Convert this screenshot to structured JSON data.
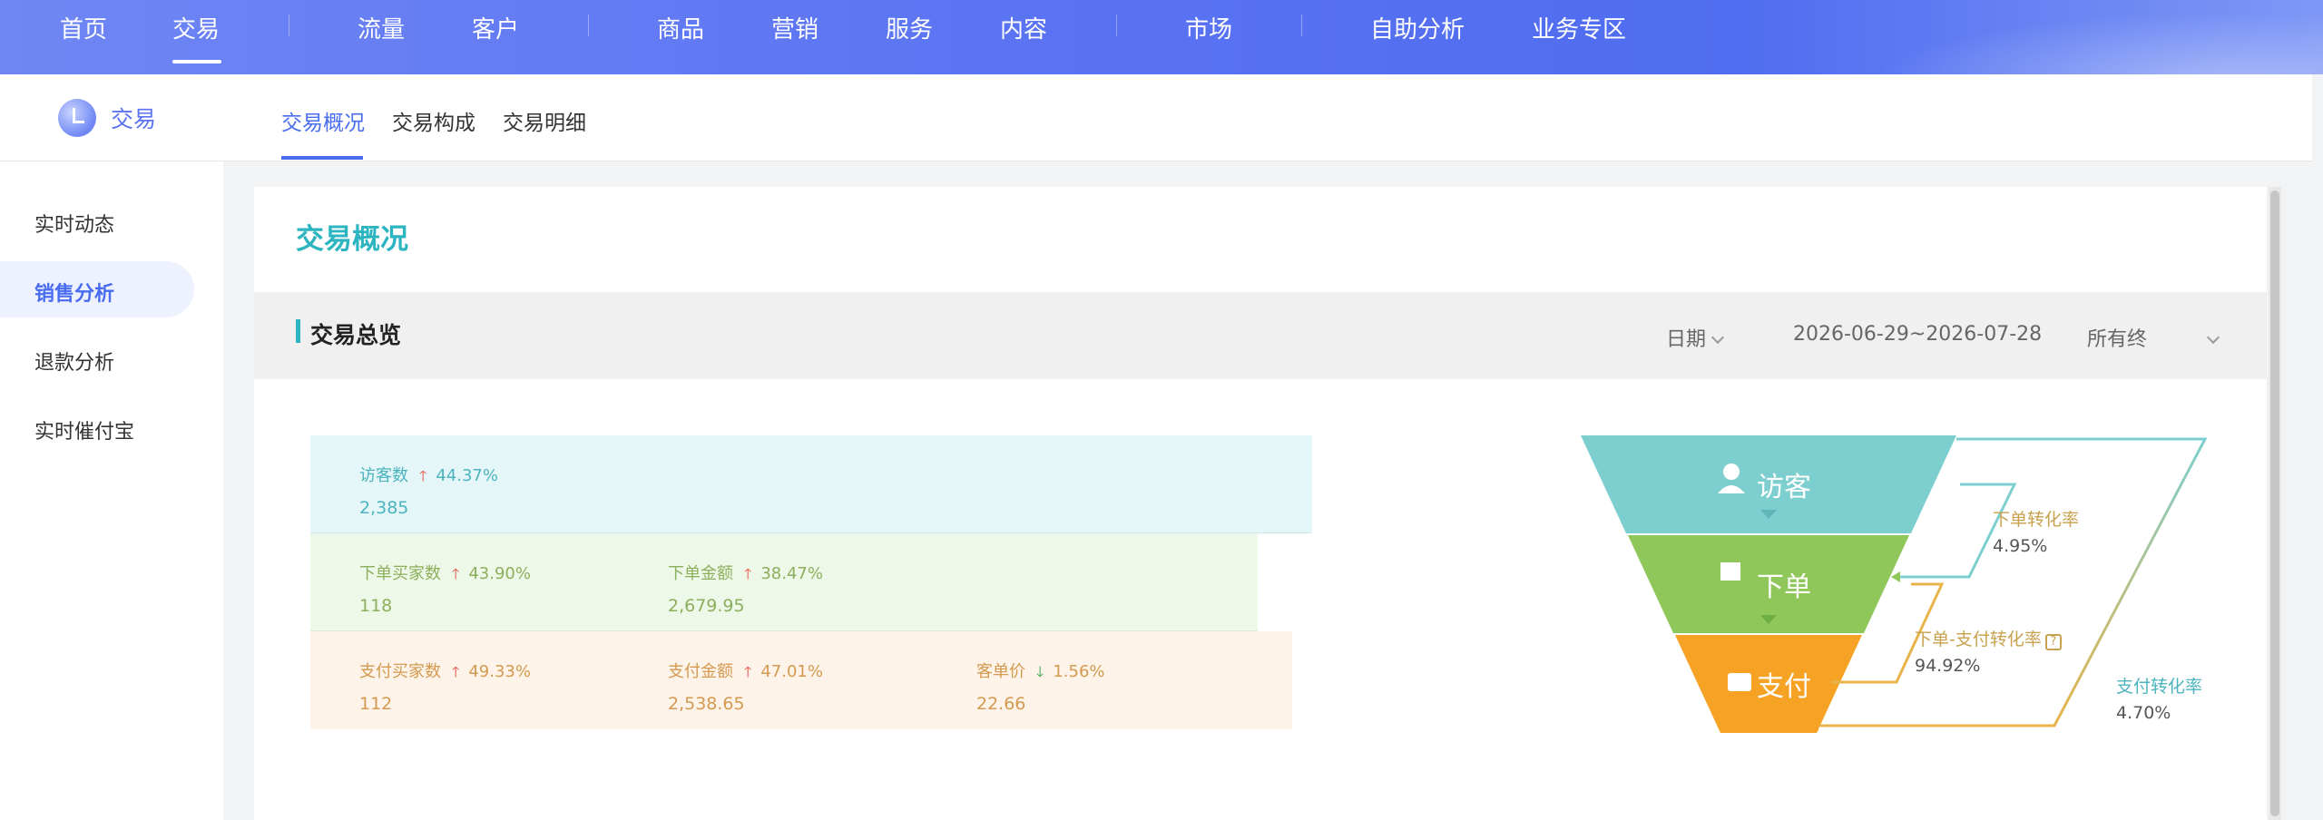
{
  "topnav": {
    "items": [
      "首页",
      "交易",
      "流量",
      "客户",
      "商品",
      "营销",
      "服务",
      "内容",
      "市场",
      "自助分析",
      "业务专区"
    ],
    "active": "交易"
  },
  "subheader": {
    "brand": "交易",
    "tabs": [
      "交易概况",
      "交易构成",
      "交易明细"
    ],
    "active_tab": "交易概况"
  },
  "sidebar": {
    "items": [
      "实时动态",
      "销售分析",
      "退款分析",
      "实时催付宝"
    ],
    "active": "销售分析"
  },
  "main": {
    "title": "交易概况",
    "section_title": "交易总览",
    "filters": {
      "date_label": "日期",
      "date_range": "2026-06-29~2026-07-28",
      "terminal": "所有终"
    }
  },
  "metrics": {
    "visitors": {
      "label": "访客数",
      "change": "44.37%",
      "direction": "up",
      "value": "2,385"
    },
    "order_buyers": {
      "label": "下单买家数",
      "change": "43.90%",
      "direction": "up",
      "value": "118"
    },
    "order_amount": {
      "label": "下单金额",
      "change": "38.47%",
      "direction": "up",
      "value": "2,679.95"
    },
    "pay_buyers": {
      "label": "支付买家数",
      "change": "49.33%",
      "direction": "up",
      "value": "112"
    },
    "pay_amount": {
      "label": "支付金额",
      "change": "47.01%",
      "direction": "up",
      "value": "2,538.65"
    },
    "unit_price": {
      "label": "客单价",
      "change": "1.56%",
      "direction": "down",
      "value": "22.66"
    }
  },
  "funnel": {
    "stages": [
      "访客",
      "下单",
      "支付"
    ],
    "rates": {
      "order_rate": {
        "label": "下单转化率",
        "value": "4.95%"
      },
      "order_pay_rate": {
        "label": "下单-支付转化率",
        "value": "94.92%"
      },
      "pay_rate": {
        "label": "支付转化率",
        "value": "4.70%"
      }
    },
    "colors": {
      "visitor": "#7dcfcf",
      "order": "#8fc75a",
      "pay": "#f6a224",
      "teal_line": "#7dcfcf",
      "gold_line": "#e8b44a"
    }
  },
  "colors": {
    "accent": "#4a6cf0",
    "teal": "#2cb5c0",
    "up": "#e54d42",
    "down": "#3aa54a"
  }
}
